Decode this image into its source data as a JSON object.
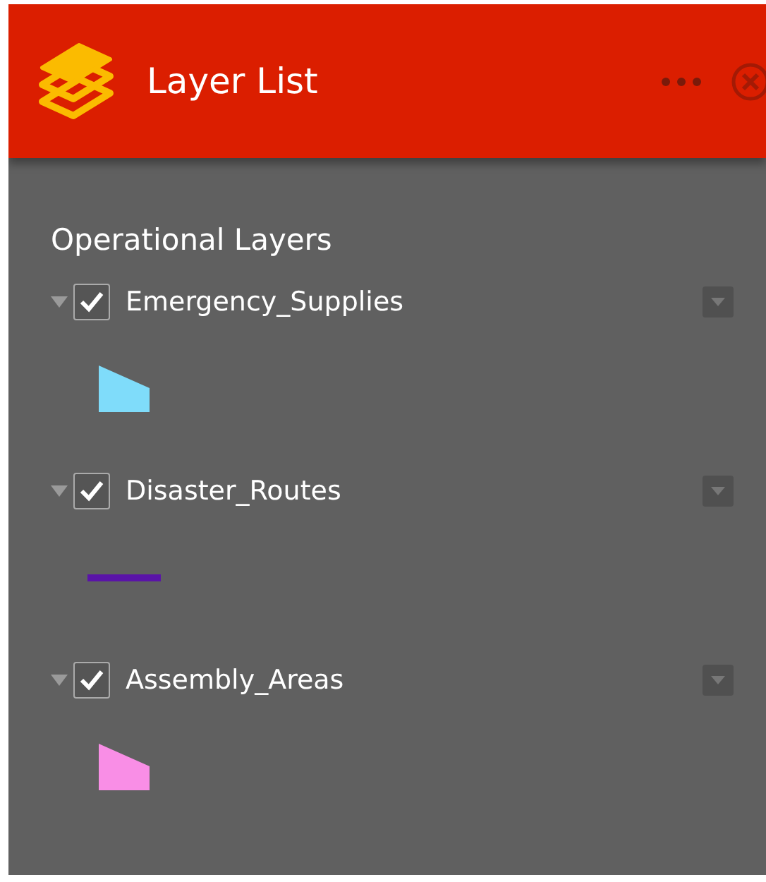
{
  "panel": {
    "title": "Layer List"
  },
  "section": {
    "title": "Operational Layers"
  },
  "layers": [
    {
      "name": "Emergency_Supplies",
      "checked": true,
      "expanded": true,
      "legend": {
        "kind": "polygon",
        "color": "#7fdcfa"
      }
    },
    {
      "name": "Disaster_Routes",
      "checked": true,
      "expanded": true,
      "legend": {
        "kind": "line",
        "color": "#5a14a8"
      }
    },
    {
      "name": "Assembly_Areas",
      "checked": true,
      "expanded": true,
      "legend": {
        "kind": "polygon",
        "color": "#f98ee6"
      }
    }
  ]
}
